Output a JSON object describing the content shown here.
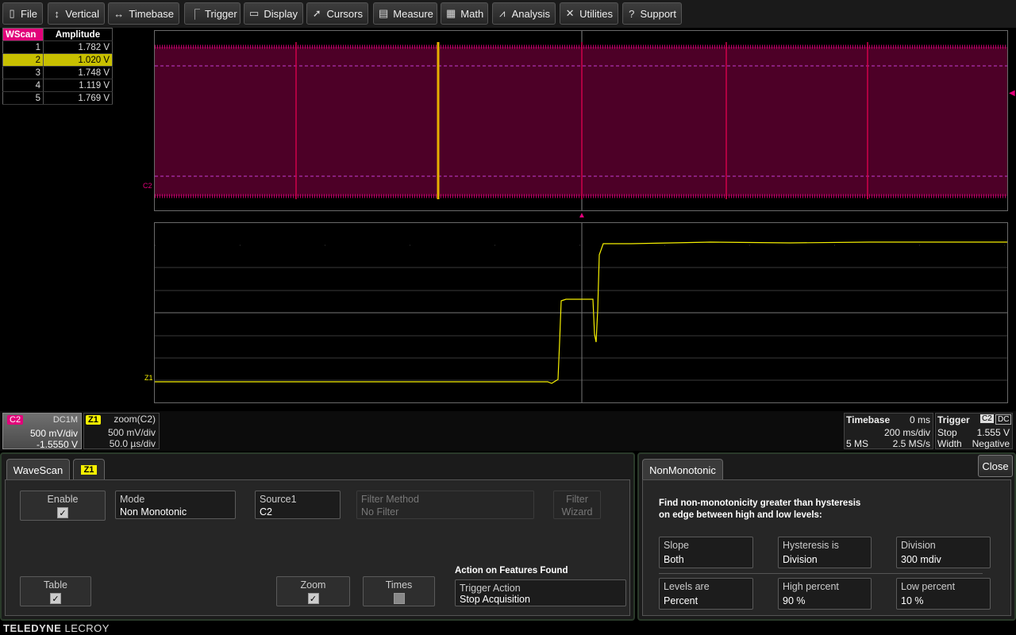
{
  "menu": {
    "file": "File",
    "vertical": "Vertical",
    "timebase": "Timebase",
    "trigger": "Trigger",
    "display": "Display",
    "cursors": "Cursors",
    "measure": "Measure",
    "math": "Math",
    "analysis": "Analysis",
    "utilities": "Utilities",
    "support": "Support"
  },
  "wavescan_table": {
    "tag": "WScan",
    "header": "Amplitude",
    "selected_row": 2,
    "rows": [
      {
        "index": "1",
        "value": "1.782 V"
      },
      {
        "index": "2",
        "value": "1.020 V"
      },
      {
        "index": "3",
        "value": "1.748 V"
      },
      {
        "index": "4",
        "value": "1.119 V"
      },
      {
        "index": "5",
        "value": "1.769 V"
      }
    ]
  },
  "grid_labels": {
    "c2": "C2",
    "z1": "Z1"
  },
  "colors": {
    "c2_trace": "#e2007a",
    "z1_trace": "#f6f000",
    "accent_green": "#2a3a2a"
  },
  "channel_c2": {
    "tag": "C2",
    "coupling": "DC1M",
    "vdiv": "500 mV/div",
    "offset": "-1.5550 V"
  },
  "channel_z1": {
    "tag": "Z1",
    "name": "zoom(C2)",
    "vdiv": "500 mV/div",
    "tdiv": "50.0 µs/div"
  },
  "timebase": {
    "title": "Timebase",
    "delay": "0 ms",
    "tdiv": "200 ms/div",
    "samples": "5 MS",
    "rate": "2.5 MS/s"
  },
  "trigger": {
    "title": "Trigger",
    "src": "C2",
    "coupling": "DC",
    "mode": "Stop",
    "level": "1.555 V",
    "type": "Width",
    "slope": "Negative"
  },
  "wavescan_dialog": {
    "tab1": "WaveScan",
    "tab2": "Z1",
    "enable_label": "Enable",
    "mode_label": "Mode",
    "mode_value": "Non Monotonic",
    "source_label": "Source1",
    "source_value": "C2",
    "filter_method_label": "Filter Method",
    "filter_method_value": "No Filter",
    "filter_wizard_line1": "Filter",
    "filter_wizard_line2": "Wizard",
    "table_label": "Table",
    "zoom_label": "Zoom",
    "times_label": "Times",
    "action_heading": "Action on Features Found",
    "trigger_action_label": "Trigger Action",
    "trigger_action_value": "Stop Acquisition"
  },
  "nonmono_dialog": {
    "tab": "NonMonotonic",
    "close": "Close",
    "info_line1": "Find non-monotonicity greater than hysteresis",
    "info_line2": "on edge between high and low levels:",
    "slope_label": "Slope",
    "slope_value": "Both",
    "hysteresis_label": "Hysteresis is",
    "hysteresis_value": "Division",
    "division_label": "Division",
    "division_value": "300 mdiv",
    "levels_label": "Levels are",
    "levels_value": "Percent",
    "high_label": "High percent",
    "high_value": "90 %",
    "low_label": "Low percent",
    "low_value": "10 %"
  },
  "brand": {
    "bold": "TELEDYNE",
    "light": "LECROY"
  }
}
